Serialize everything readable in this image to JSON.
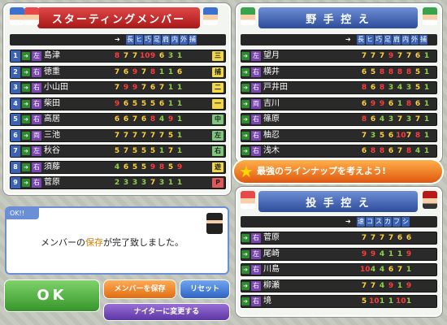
{
  "colors": {
    "stat_high": "#ff3b3b",
    "stat_mid": "#ffd23a",
    "stat_low": "#8fd24a",
    "pos_yellow": "#f0d84a",
    "pos_green": "#7fc77f",
    "pos_red": "#e05858"
  },
  "starting": {
    "title": "スターティングメンバー",
    "headers": [
      "長",
      "ヒ",
      "巧",
      "足",
      "肩",
      "内",
      "外",
      "捕"
    ],
    "rows": [
      {
        "num": "1",
        "hand": "左",
        "name": "島津",
        "stats": [
          "8",
          "7",
          "7",
          "10",
          "9",
          "6",
          "3",
          "1"
        ],
        "pos": "三"
      },
      {
        "num": "2",
        "hand": "右",
        "name": "徳重",
        "stats": [
          "7",
          "6",
          "9",
          "7",
          "8",
          "1",
          "1",
          "6"
        ],
        "pos": "捕"
      },
      {
        "num": "3",
        "hand": "右",
        "name": "小山田",
        "stats": [
          "7",
          "9",
          "9",
          "7",
          "6",
          "7",
          "1",
          "1"
        ],
        "pos": "二"
      },
      {
        "num": "4",
        "hand": "右",
        "name": "柴田",
        "stats": [
          "9",
          "6",
          "5",
          "5",
          "5",
          "6",
          "1",
          "1"
        ],
        "pos": "一"
      },
      {
        "num": "5",
        "hand": "右",
        "name": "高居",
        "stats": [
          "6",
          "6",
          "7",
          "6",
          "8",
          "4",
          "9",
          "1"
        ],
        "pos": "中"
      },
      {
        "num": "6",
        "hand": "両",
        "name": "三池",
        "stats": [
          "7",
          "7",
          "7",
          "7",
          "7",
          "7",
          "5",
          "1"
        ],
        "pos": "左"
      },
      {
        "num": "7",
        "hand": "左",
        "name": "秋谷",
        "stats": [
          "5",
          "7",
          "5",
          "5",
          "5",
          "1",
          "7",
          "1"
        ],
        "pos": "右"
      },
      {
        "num": "8",
        "hand": "右",
        "name": "須藤",
        "stats": [
          "4",
          "6",
          "5",
          "5",
          "9",
          "8",
          "5",
          "9"
        ],
        "pos": "遊"
      },
      {
        "num": "9",
        "hand": "右",
        "name": "菅原",
        "stats": [
          "2",
          "3",
          "3",
          "3",
          "7",
          "3",
          "1",
          "1"
        ],
        "pos": "P"
      }
    ]
  },
  "bench": {
    "title": "野 手 控 え",
    "headers": [
      "長",
      "ヒ",
      "巧",
      "足",
      "肩",
      "内",
      "外",
      "捕"
    ],
    "rows": [
      {
        "hand": "左",
        "name": "望月",
        "stats": [
          "7",
          "7",
          "7",
          "9",
          "7",
          "7",
          "6",
          "1"
        ]
      },
      {
        "hand": "右",
        "name": "横井",
        "stats": [
          "6",
          "5",
          "8",
          "8",
          "8",
          "8",
          "5",
          "1"
        ]
      },
      {
        "hand": "右",
        "name": "戸井田",
        "stats": [
          "8",
          "6",
          "8",
          "3",
          "4",
          "3",
          "5",
          "1"
        ]
      },
      {
        "hand": "両",
        "name": "吉川",
        "stats": [
          "6",
          "9",
          "9",
          "6",
          "1",
          "8",
          "6",
          "1"
        ]
      },
      {
        "hand": "右",
        "name": "篠原",
        "stats": [
          "8",
          "6",
          "4",
          "3",
          "7",
          "3",
          "7",
          "1"
        ]
      },
      {
        "hand": "右",
        "name": "柚忍",
        "stats": [
          "7",
          "3",
          "5",
          "6",
          "10",
          "7",
          "8",
          "1"
        ]
      },
      {
        "hand": "右",
        "name": "浅木",
        "stats": [
          "6",
          "8",
          "8",
          "6",
          "7",
          "8",
          "4",
          "1"
        ]
      }
    ]
  },
  "banner": "最強のラインナップを考えよう!",
  "pitchers": {
    "title": "投 手 控 え",
    "headers": [
      "速",
      "コ",
      "ス",
      "カ",
      "フ",
      "シ"
    ],
    "rows": [
      {
        "hand": "右",
        "name": "菅原",
        "stats": [
          "7",
          "7",
          "7",
          "7",
          "6",
          "6"
        ]
      },
      {
        "hand": "左",
        "name": "尾崎",
        "stats": [
          "9",
          "9",
          "4",
          "1",
          "1",
          "9"
        ]
      },
      {
        "hand": "右",
        "name": "川島",
        "stats": [
          "10",
          "4",
          "4",
          "6",
          "7",
          "1"
        ]
      },
      {
        "hand": "右",
        "name": "柳瀬",
        "stats": [
          "7",
          "7",
          "4",
          "9",
          "1",
          "9"
        ]
      },
      {
        "hand": "右",
        "name": "境",
        "stats": [
          "5",
          "10",
          "1",
          "1",
          "10",
          "1"
        ]
      }
    ]
  },
  "message": {
    "header": "OK!!",
    "pre": "メンバーの",
    "highlight": "保存",
    "post": "が完了致しました。"
  },
  "buttons": {
    "ok": "OK",
    "save": "メンバーを保存",
    "reset": "リセット",
    "night": "ナイターに変更する"
  }
}
